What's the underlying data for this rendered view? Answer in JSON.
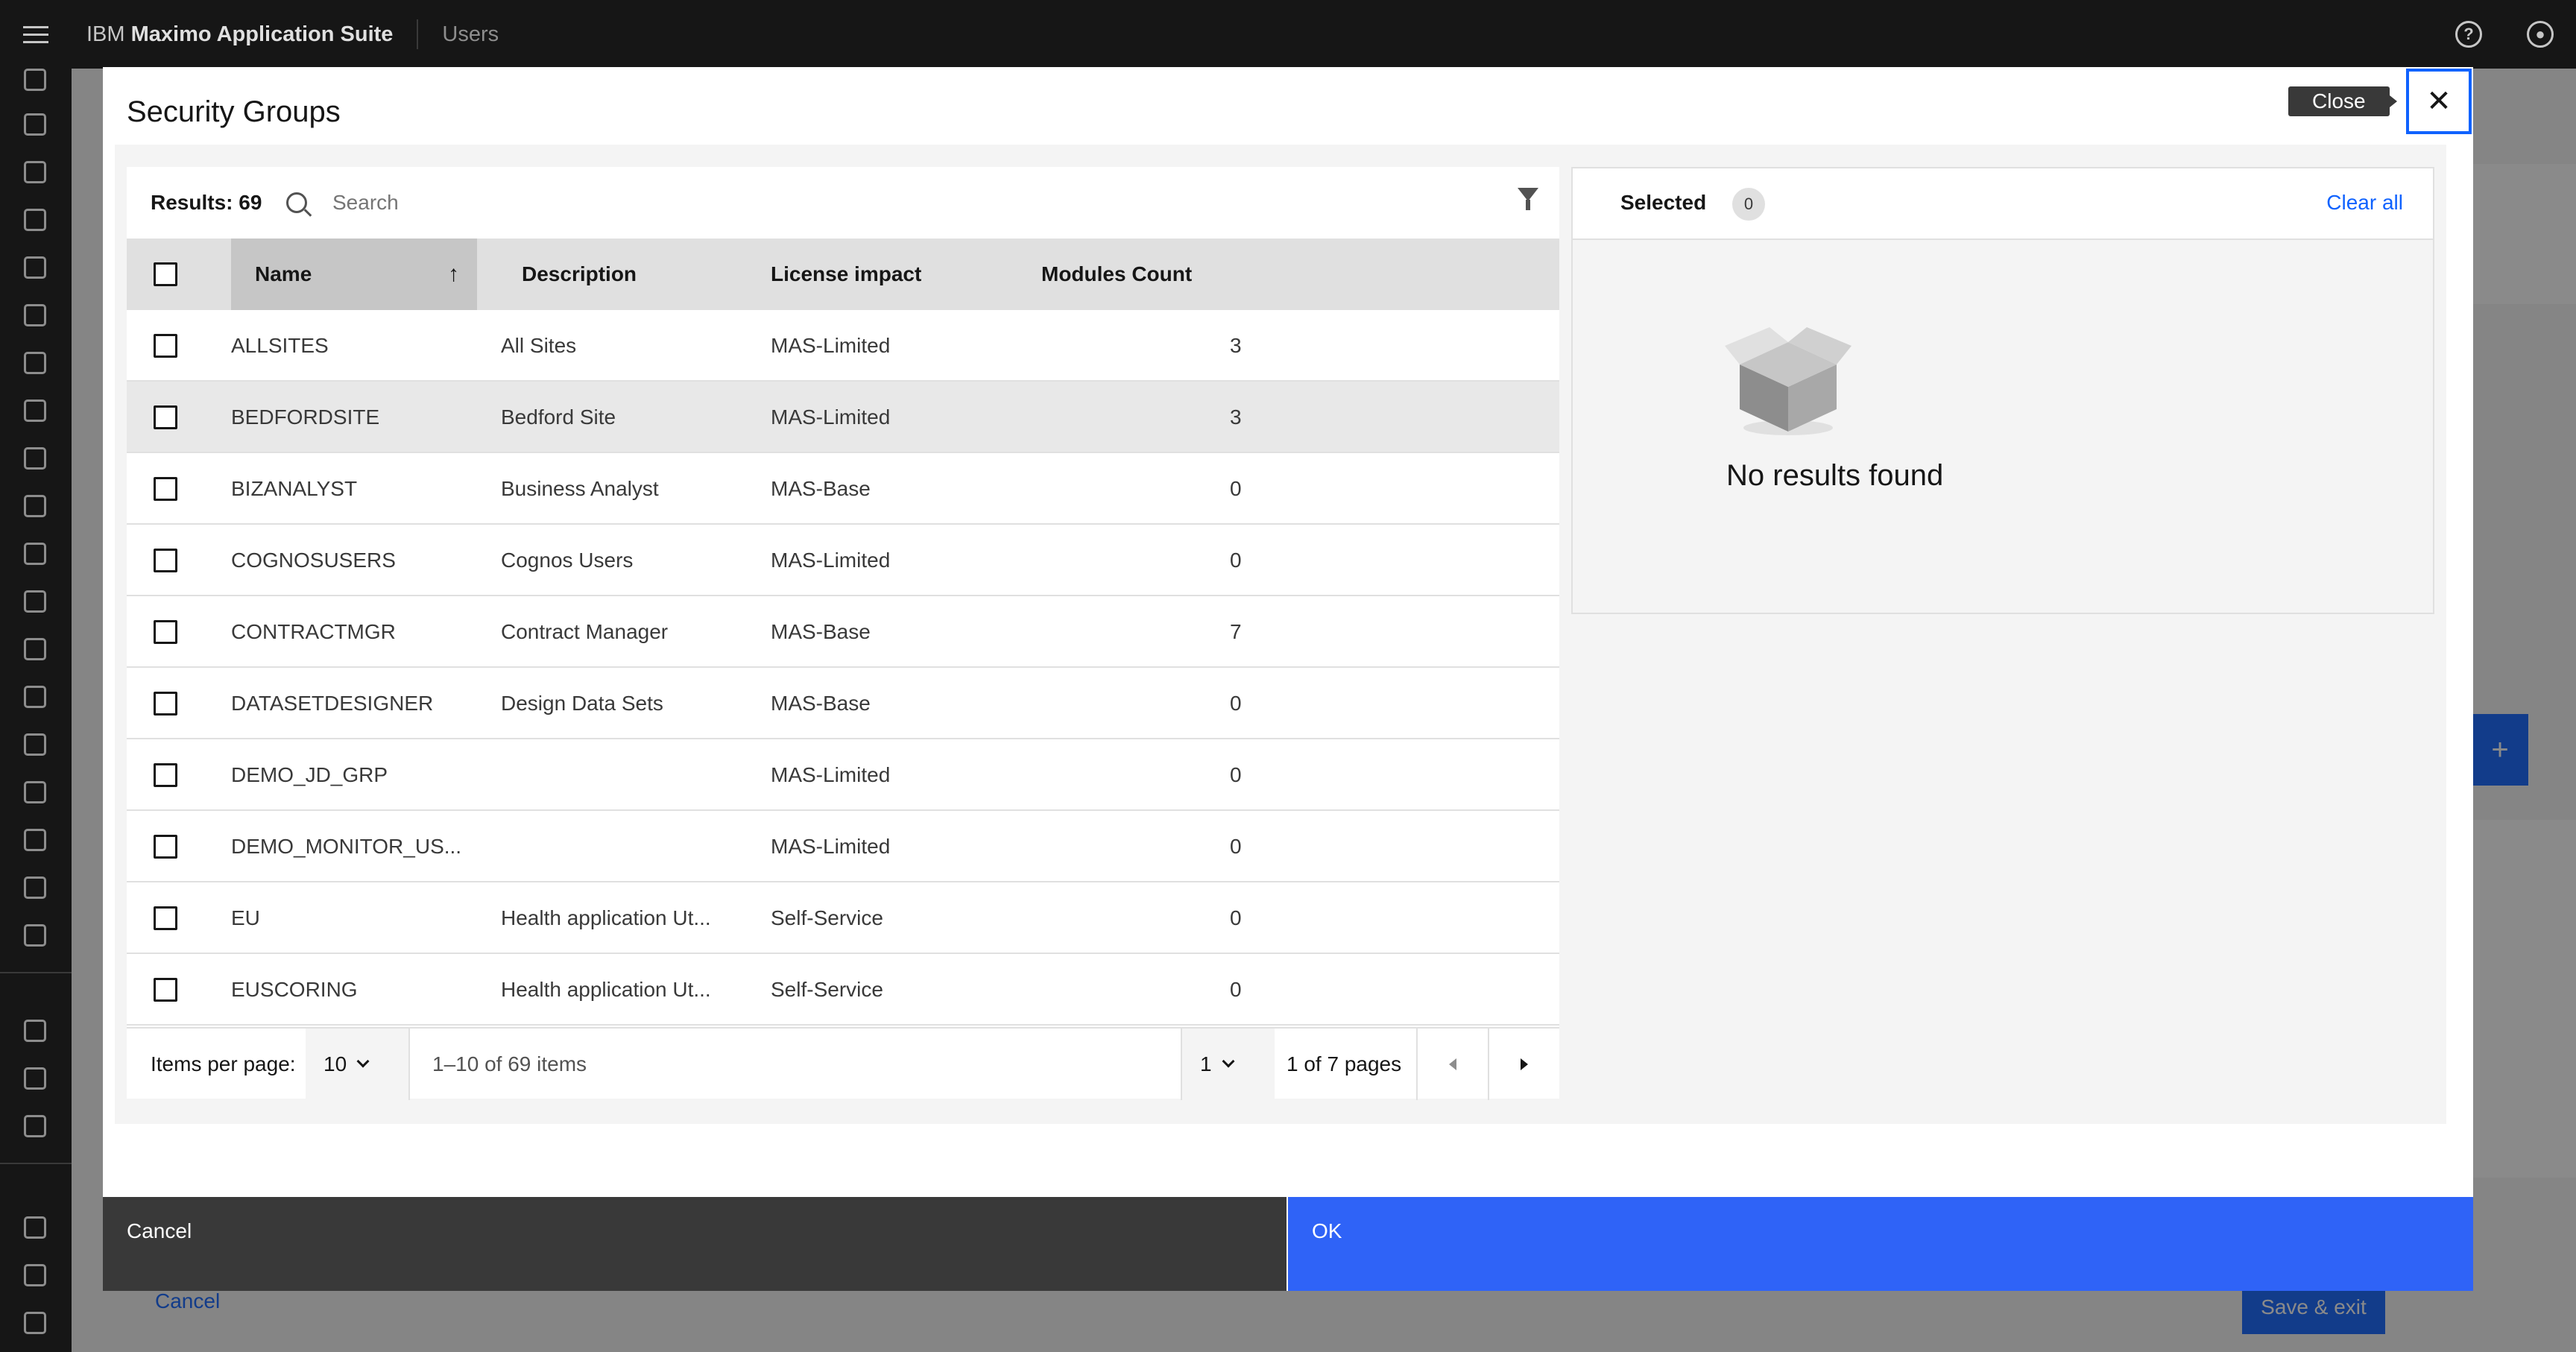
{
  "header": {
    "brand_prefix": "IBM",
    "brand_name": "Maximo Application Suite",
    "breadcrumb": "Users",
    "help_icon": "help-icon",
    "user_icon": "user-avatar-icon"
  },
  "background": {
    "cancel_label": "Cancel",
    "save_exit_label": "Save & exit",
    "add_label": "+"
  },
  "modal": {
    "title": "Security Groups",
    "close_tooltip": "Close",
    "close_glyph": "✕",
    "results_label": "Results: 69",
    "search_placeholder": "Search",
    "columns": {
      "name": "Name",
      "description": "Description",
      "license_impact": "License impact",
      "modules_count": "Modules Count"
    },
    "sort_glyph": "↑",
    "rows": [
      {
        "name": "ALLSITES",
        "description": "All Sites",
        "license": "MAS-Limited",
        "modules": "3"
      },
      {
        "name": "BEDFORDSITE",
        "description": "Bedford Site",
        "license": "MAS-Limited",
        "modules": "3"
      },
      {
        "name": "BIZANALYST",
        "description": "Business Analyst",
        "license": "MAS-Base",
        "modules": "0"
      },
      {
        "name": "COGNOSUSERS",
        "description": "Cognos Users",
        "license": "MAS-Limited",
        "modules": "0"
      },
      {
        "name": "CONTRACTMGR",
        "description": "Contract Manager",
        "license": "MAS-Base",
        "modules": "7"
      },
      {
        "name": "DATASETDESIGNER",
        "description": "Design Data Sets",
        "license": "MAS-Base",
        "modules": "0"
      },
      {
        "name": "DEMO_JD_GRP",
        "description": "",
        "license": "MAS-Limited",
        "modules": "0"
      },
      {
        "name": "DEMO_MONITOR_US...",
        "description": "",
        "license": "MAS-Limited",
        "modules": "0"
      },
      {
        "name": "EU",
        "description": "Health application Ut...",
        "license": "Self-Service",
        "modules": "0"
      },
      {
        "name": "EUSCORING",
        "description": "Health application Ut...",
        "license": "Self-Service",
        "modules": "0"
      }
    ],
    "pagination": {
      "items_per_page_label": "Items per page:",
      "items_per_page_value": "10",
      "range_text": "1–10 of 69 items",
      "page_value": "1",
      "pages_text": "1 of 7 pages"
    },
    "selected": {
      "title": "Selected",
      "count": "0",
      "clear_all": "Clear all",
      "empty_text": "No results found"
    },
    "footer": {
      "cancel": "Cancel",
      "ok": "OK"
    }
  },
  "colors": {
    "primary": "#0f62fe",
    "header_bg": "#161616",
    "ok_button": "#2f63f7",
    "cancel_button": "#393939"
  }
}
